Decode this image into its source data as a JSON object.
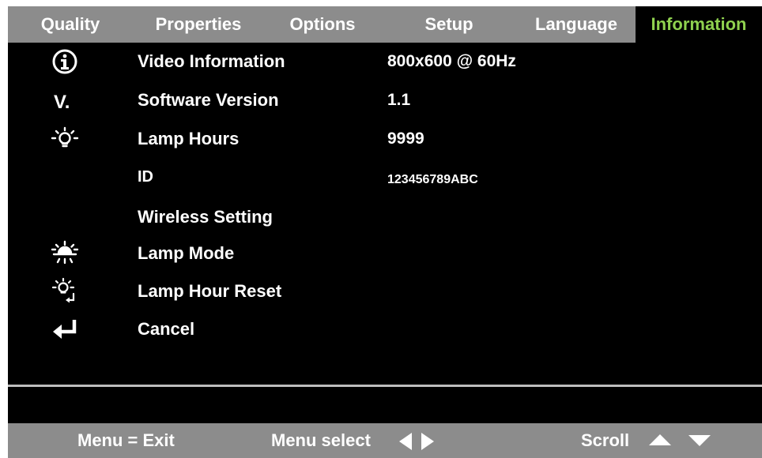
{
  "tabs": [
    {
      "label": "Quality",
      "active": false
    },
    {
      "label": "Properties",
      "active": false
    },
    {
      "label": "Options",
      "active": false
    },
    {
      "label": "Setup",
      "active": false
    },
    {
      "label": "Language",
      "active": false
    },
    {
      "label": "Information",
      "active": true
    }
  ],
  "info": {
    "video_information": {
      "label": "Video Information",
      "value": "800x600 @ 60Hz",
      "icon": "info-circle-icon"
    },
    "software_version": {
      "label": "Software Version",
      "value": "1.1",
      "icon": "version-v-icon"
    },
    "lamp_hours": {
      "label": "Lamp Hours",
      "value": "9999",
      "icon": "lamp-bulb-icon"
    },
    "id": {
      "label": "ID",
      "value": "123456789ABC"
    }
  },
  "menu": {
    "wireless_setting": {
      "label": "Wireless Setting"
    },
    "lamp_mode": {
      "label": "Lamp Mode",
      "icon": "lamp-mode-icon"
    },
    "lamp_hour_reset": {
      "label": "Lamp Hour Reset",
      "icon": "lamp-reset-icon"
    },
    "cancel": {
      "label": "Cancel",
      "icon": "return-arrow-icon"
    }
  },
  "footer": {
    "exit_hint": "Menu = Exit",
    "select_hint": "Menu select",
    "scroll_hint": "Scroll"
  },
  "colors": {
    "bar": "#8c8c8c",
    "background": "#000000",
    "active_tab_text": "#8fd14f",
    "text": "#ffffff"
  }
}
